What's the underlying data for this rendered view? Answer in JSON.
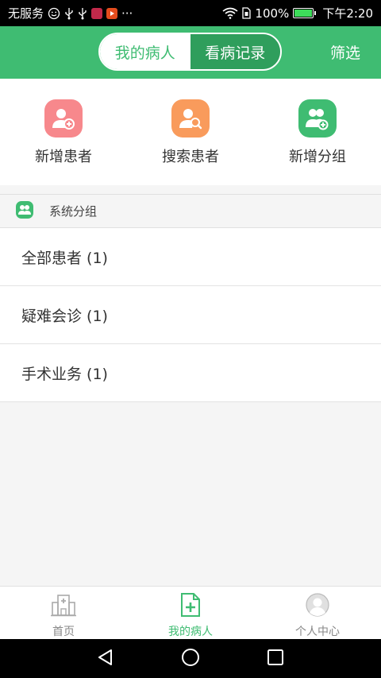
{
  "status_bar": {
    "carrier": "无服务",
    "battery": "100%",
    "time": "下午2:20",
    "more_dots": "···"
  },
  "header": {
    "tabs": [
      {
        "label": "我的病人",
        "active": true
      },
      {
        "label": "看病记录",
        "active": false
      }
    ],
    "filter_label": "筛选"
  },
  "actions": [
    {
      "label": "新增患者",
      "icon": "add-patient-icon",
      "color": "#f7888c"
    },
    {
      "label": "搜索患者",
      "icon": "search-patient-icon",
      "color": "#f99b5c"
    },
    {
      "label": "新增分组",
      "icon": "add-group-icon",
      "color": "#3fbc72"
    }
  ],
  "group_section": {
    "title": "系统分组",
    "items": [
      {
        "label": "全部患者 (1)"
      },
      {
        "label": "疑难会诊 (1)"
      },
      {
        "label": "手术业务 (1)"
      }
    ]
  },
  "bottom_nav": {
    "items": [
      {
        "label": "首页",
        "icon": "hospital-icon",
        "active": false
      },
      {
        "label": "我的病人",
        "icon": "patient-file-icon",
        "active": true
      },
      {
        "label": "个人中心",
        "icon": "profile-icon",
        "active": false
      }
    ]
  },
  "colors": {
    "primary": "#3fbc72",
    "primary_dark": "#2f9e5c"
  }
}
